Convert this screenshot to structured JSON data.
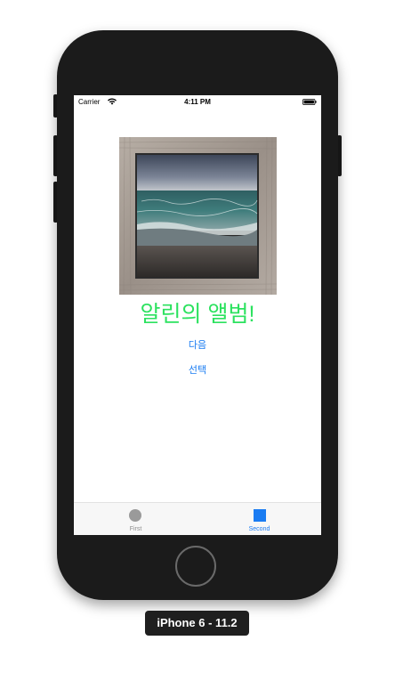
{
  "status_bar": {
    "carrier": "Carrier",
    "time": "4:11 PM",
    "wifi_icon": "wifi-icon",
    "battery_icon": "battery-icon"
  },
  "album": {
    "image_icon": "framed-sea-photo",
    "title": "알린의 앨범!",
    "title_color": "#2ce25f"
  },
  "buttons": {
    "next_label": "다음",
    "select_label": "선택",
    "color": "#1a7cf2"
  },
  "tab_bar": {
    "tabs": [
      {
        "label": "First",
        "icon": "circle-icon",
        "selected": false
      },
      {
        "label": "Second",
        "icon": "square-icon",
        "selected": true
      }
    ],
    "selected_color": "#1a7cf2",
    "unselected_color": "#8e8e8e"
  },
  "device_caption": "iPhone 6 - 11.2"
}
